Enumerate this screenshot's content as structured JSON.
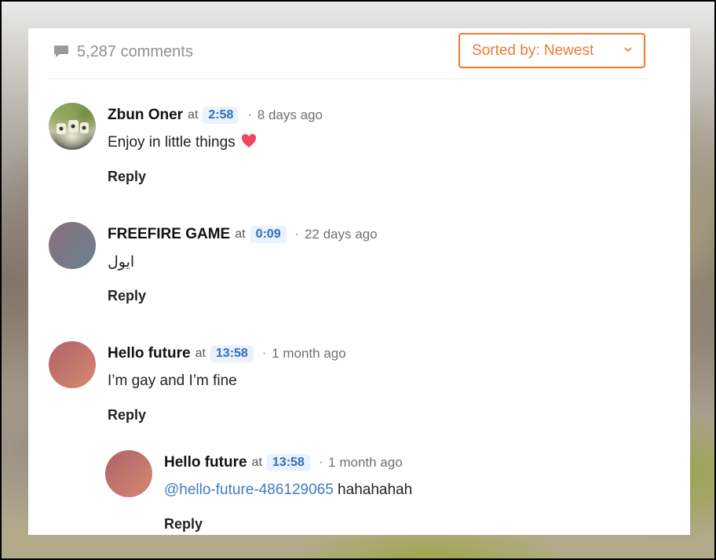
{
  "header": {
    "comment_count": "5,287 comments",
    "sort_label": "Sorted by: Newest"
  },
  "colors": {
    "accent": "#f07a33",
    "timestamp_bg": "#eaf2fb",
    "timestamp_text": "#2e6cc2",
    "mention": "#3b7dc4"
  },
  "comments": [
    {
      "author": "Zbun Oner",
      "at": "at",
      "timestamp": "2:58",
      "ago": "8 days ago",
      "text": "Enjoy in little things",
      "emoji": "heart-icon",
      "reply": "Reply"
    },
    {
      "author": "FREEFIRE GAME",
      "at": "at",
      "timestamp": "0:09",
      "ago": "22 days ago",
      "text": "ايول",
      "reply": "Reply"
    },
    {
      "author": "Hello future",
      "at": "at",
      "timestamp": "13:58",
      "ago": "1 month ago",
      "text": "I’m gay and I’m fine",
      "reply": "Reply"
    },
    {
      "author": "Hello future",
      "at": "at",
      "timestamp": "13:58",
      "ago": "1 month ago",
      "mention": "@hello-future-486129065",
      "text": " hahahahah",
      "reply": "Reply"
    }
  ]
}
